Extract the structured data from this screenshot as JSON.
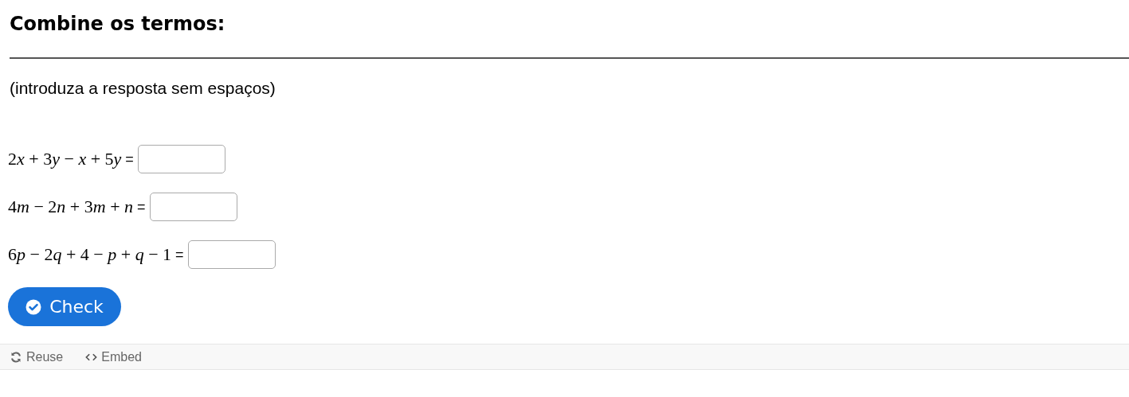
{
  "title": "Combine os termos:",
  "instruction": "(introduza a resposta sem espaços)",
  "exercises": [
    {
      "expression": "2x + 3y − x + 5y",
      "equals": "="
    },
    {
      "expression": "4m − 2n + 3m + n",
      "equals": "="
    },
    {
      "expression": "6p − 2q + 4 − p + q − 1",
      "equals": "="
    }
  ],
  "check_button": "Check",
  "footer": [
    {
      "kind": "reuse",
      "label": "Reuse"
    },
    {
      "kind": "embed",
      "label": "Embed"
    }
  ]
}
